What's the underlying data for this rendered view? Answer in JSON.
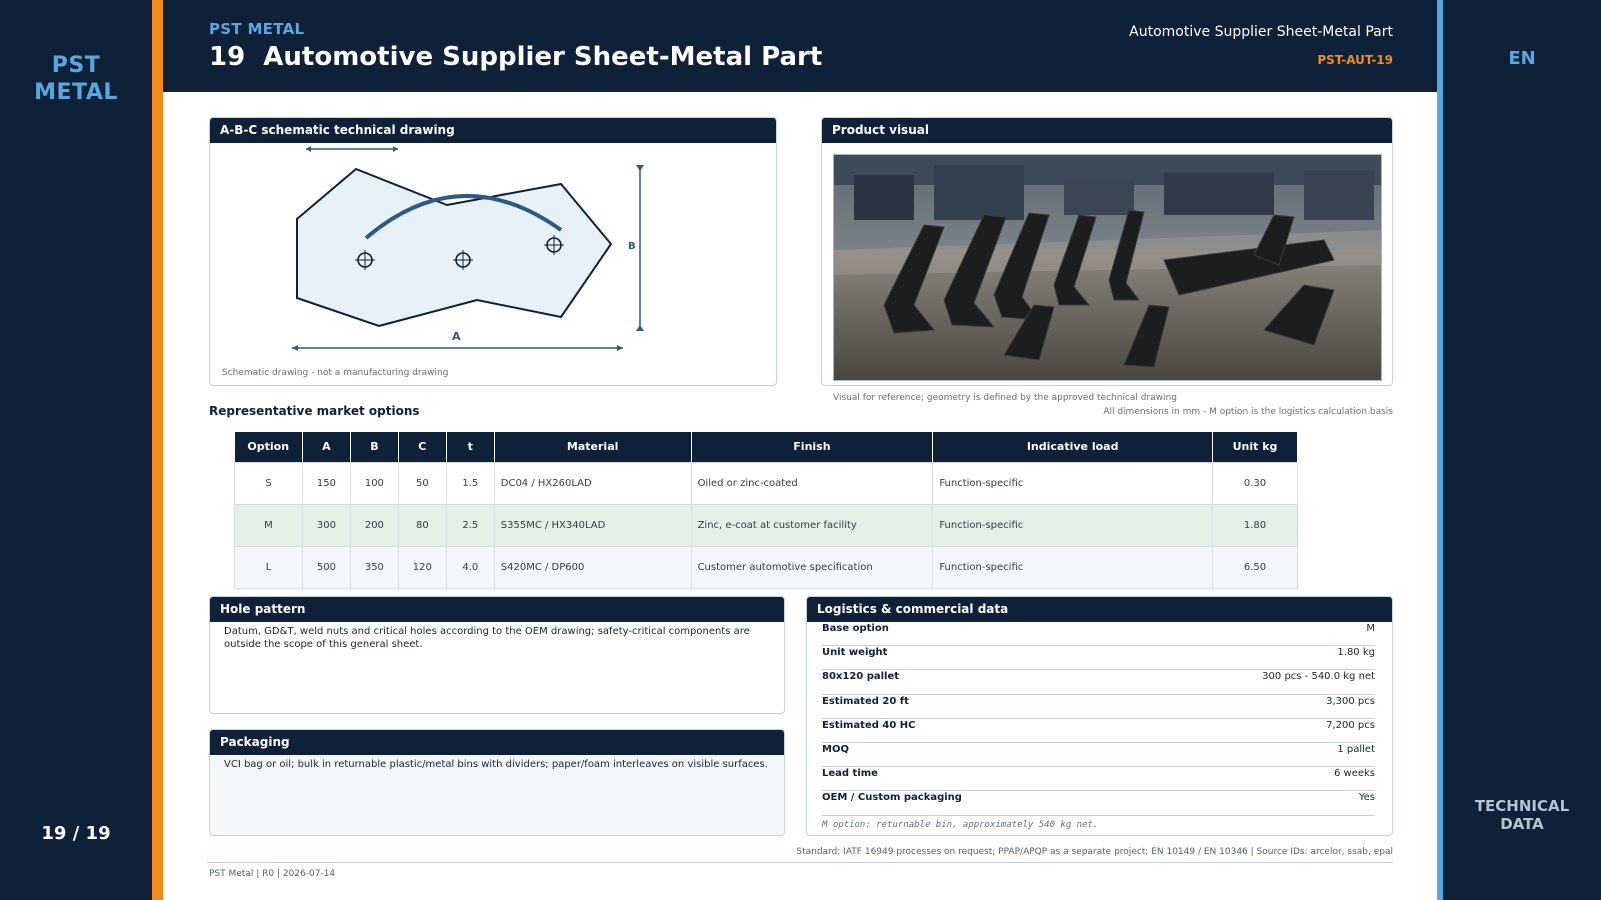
{
  "sidebar": {
    "brand": "PST\nMETAL",
    "page_counter": "19 / 19"
  },
  "header": {
    "brand": "PST METAL",
    "title": "19  Automotive Supplier Sheet-Metal Part",
    "subtitle": "Automotive Supplier Sheet-Metal Part",
    "code": "PST-AUT-19"
  },
  "right_rail": {
    "lang": "EN",
    "section": "TECHNICAL\nDATA"
  },
  "drawing": {
    "title": "A-B-C schematic technical drawing",
    "label_a": "A",
    "label_b": "B",
    "note": "Schematic drawing - not a manufacturing drawing"
  },
  "visual": {
    "title": "Product visual",
    "note": "Visual for reference; geometry is defined by the approved technical drawing",
    "dimensions_note": "All dimensions in mm - M option is the logistics calculation basis"
  },
  "options": {
    "title": "Representative market options",
    "headers": [
      "Option",
      "A",
      "B",
      "C",
      "t",
      "Material",
      "Finish",
      "Indicative load",
      "Unit kg"
    ],
    "rows": [
      [
        "S",
        "150",
        "100",
        "50",
        "1.5",
        "DC04 / HX260LAD",
        "Oiled or zinc-coated",
        "Function-specific",
        "0.30"
      ],
      [
        "M",
        "300",
        "200",
        "80",
        "2.5",
        "S355MC / HX340LAD",
        "Zinc, e-coat at customer facility",
        "Function-specific",
        "1.80"
      ],
      [
        "L",
        "500",
        "350",
        "120",
        "4.0",
        "S420MC / DP600",
        "Customer automotive specification",
        "Function-specific",
        "6.50"
      ]
    ]
  },
  "hole_pattern": {
    "title": "Hole pattern",
    "text": "Datum, GD&T, weld nuts and critical holes according to the OEM drawing; safety-critical components are outside the scope of this general sheet."
  },
  "packaging": {
    "title": "Packaging",
    "text": "VCI bag or oil; bulk in returnable plastic/metal bins with dividers; paper/foam interleaves on visible surfaces."
  },
  "logistics": {
    "title": "Logistics & commercial data",
    "rows": [
      [
        "Base option",
        "M"
      ],
      [
        "Unit weight",
        "1.80 kg"
      ],
      [
        "80x120 pallet",
        "300 pcs - 540.0 kg net"
      ],
      [
        "Estimated 20 ft",
        "3,300 pcs"
      ],
      [
        "Estimated 40 HC",
        "7,200 pcs"
      ],
      [
        "MOQ",
        "1 pallet"
      ],
      [
        "Lead time",
        "6 weeks"
      ],
      [
        "OEM / Custom packaging",
        "Yes"
      ]
    ],
    "note": "M option: returnable bin, approximately 540 kg net."
  },
  "standard": "Standard: IATF 16949 processes on request; PPAP/APQP as a separate project; EN 10149 / EN 10346 | Source IDs: arcelor, ssab, epal",
  "footer": "PST Metal | R0 | 2026-07-14",
  "colors": {
    "navy": "#0e2139",
    "orange": "#f28a22",
    "blue": "#5aa7df",
    "mint": "#e3f0e6"
  }
}
